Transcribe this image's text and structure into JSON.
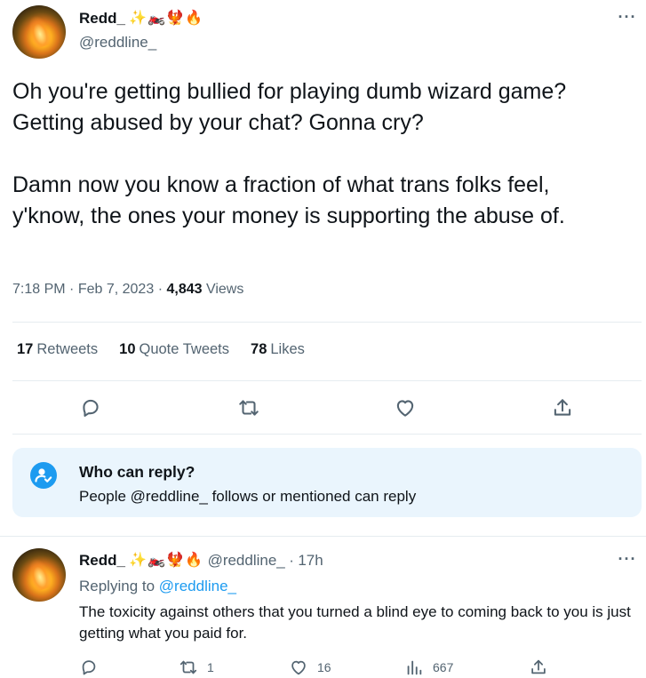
{
  "tweet": {
    "author": {
      "display_name": "Redd_",
      "emojis": "✨🏍️🐦‍🔥🔥",
      "handle": "@reddline_"
    },
    "text": "Oh you're getting bullied for playing dumb wizard game? Getting abused by your chat? Gonna cry?\n\nDamn now you know a fraction of what trans folks feel, y'know, the ones your money is supporting the abuse of.",
    "time": "7:18 PM",
    "separator": "·",
    "date": "Feb 7, 2023",
    "views_count": "4,843",
    "views_label": "Views",
    "stats": {
      "retweets_count": "17",
      "retweets_label": "Retweets",
      "quotes_count": "10",
      "quotes_label": "Quote Tweets",
      "likes_count": "78",
      "likes_label": "Likes"
    },
    "actions": [
      "reply-icon",
      "retweet-icon",
      "like-icon",
      "share-icon"
    ]
  },
  "who_can_reply": {
    "title": "Who can reply?",
    "subtitle": "People @reddline_ follows or mentioned can reply"
  },
  "reply": {
    "author": {
      "display_name": "Redd_",
      "emojis": "✨🏍️🐦‍🔥🔥",
      "handle": "@reddline_",
      "separator": "·",
      "time": "17h"
    },
    "replying_prefix": "Replying to",
    "replying_to": "@reddline_",
    "text": "The toxicity against others that you turned a blind eye to coming back to you is just getting what you paid for.",
    "actions": {
      "replies": "",
      "retweets": "1",
      "likes": "16",
      "views": "667"
    }
  },
  "colors": {
    "accent": "#1d9bf0",
    "text": "#0f1419",
    "secondary": "#536471",
    "divider": "#e6ecf0",
    "reply_box_bg": "#eaf5fd"
  }
}
